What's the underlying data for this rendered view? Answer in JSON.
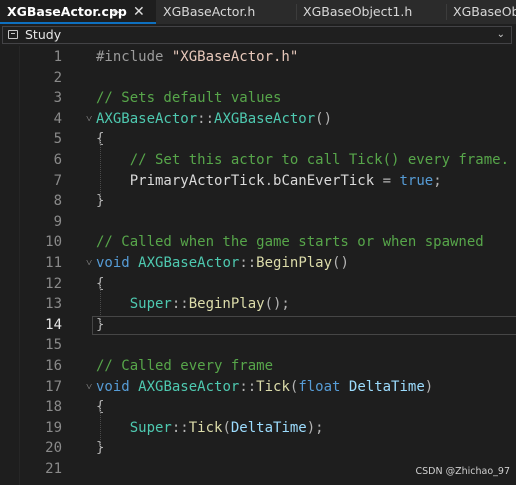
{
  "tabs": [
    {
      "label": "XGBaseActor.cpp",
      "active": true,
      "pin_icon": "pin-icon",
      "close_icon": "close-icon"
    },
    {
      "label": "XGBaseActor.h",
      "active": false
    },
    {
      "label": "XGBaseObject1.h",
      "active": false
    },
    {
      "label": "XGBaseObj",
      "active": false
    }
  ],
  "navbar": {
    "project_label": "Study",
    "project_icon": "project-icon",
    "chevron_icon": "chevron-down-icon"
  },
  "editor": {
    "current_line": 14,
    "line_numbers": [
      "1",
      "2",
      "3",
      "4",
      "5",
      "6",
      "7",
      "8",
      "9",
      "10",
      "11",
      "12",
      "13",
      "14",
      "15",
      "16",
      "17",
      "18",
      "19",
      "20",
      "21"
    ],
    "lines": [
      [
        [
          "pre",
          "#include "
        ],
        [
          "str",
          "\"XGBaseActor.h\""
        ]
      ],
      [],
      [
        [
          "cmt",
          "// Sets default values"
        ]
      ],
      [
        [
          "cls",
          "AXGBaseActor"
        ],
        [
          "pl",
          "::"
        ],
        [
          "cls",
          "AXGBaseActor"
        ],
        [
          "pl",
          "()"
        ]
      ],
      [
        [
          "pl",
          "{"
        ]
      ],
      [
        [
          "cmt",
          "    // Set this actor to call Tick() every frame."
        ]
      ],
      [
        [
          "var",
          "    PrimaryActorTick"
        ],
        [
          "pl",
          "."
        ],
        [
          "var",
          "bCanEverTick"
        ],
        [
          "pl",
          " = "
        ],
        [
          "kw",
          "true"
        ],
        [
          "pl",
          ";"
        ]
      ],
      [
        [
          "pl",
          "}"
        ]
      ],
      [],
      [
        [
          "cmt",
          "// Called when the game starts or when spawned"
        ]
      ],
      [
        [
          "kw",
          "void "
        ],
        [
          "cls",
          "AXGBaseActor"
        ],
        [
          "pl",
          "::"
        ],
        [
          "fn",
          "BeginPlay"
        ],
        [
          "pl",
          "()"
        ]
      ],
      [
        [
          "pl",
          "{"
        ]
      ],
      [
        [
          "cls",
          "    Super"
        ],
        [
          "pl",
          "::"
        ],
        [
          "fn",
          "BeginPlay"
        ],
        [
          "pl",
          "();"
        ]
      ],
      [
        [
          "pl",
          "}"
        ]
      ],
      [],
      [
        [
          "cmt",
          "// Called every frame"
        ]
      ],
      [
        [
          "kw",
          "void "
        ],
        [
          "cls",
          "AXGBaseActor"
        ],
        [
          "pl",
          "::"
        ],
        [
          "fn",
          "Tick"
        ],
        [
          "pl",
          "("
        ],
        [
          "kw",
          "float "
        ],
        [
          "par",
          "DeltaTime"
        ],
        [
          "pl",
          ")"
        ]
      ],
      [
        [
          "pl",
          "{"
        ]
      ],
      [
        [
          "cls",
          "    Super"
        ],
        [
          "pl",
          "::"
        ],
        [
          "fn",
          "Tick"
        ],
        [
          "pl",
          "("
        ],
        [
          "par",
          "DeltaTime"
        ],
        [
          "pl",
          ");"
        ]
      ],
      [
        [
          "pl",
          "}"
        ]
      ],
      []
    ]
  },
  "watermark": "CSDN @Zhichao_97",
  "colors": {
    "background": "#1e1e1e",
    "comment": "#57a64a",
    "keyword": "#569cd6",
    "class": "#4ec9b0",
    "function": "#dcdcaa",
    "string": "#e8c9bb",
    "active_tab_accent": "#0e70c0"
  }
}
